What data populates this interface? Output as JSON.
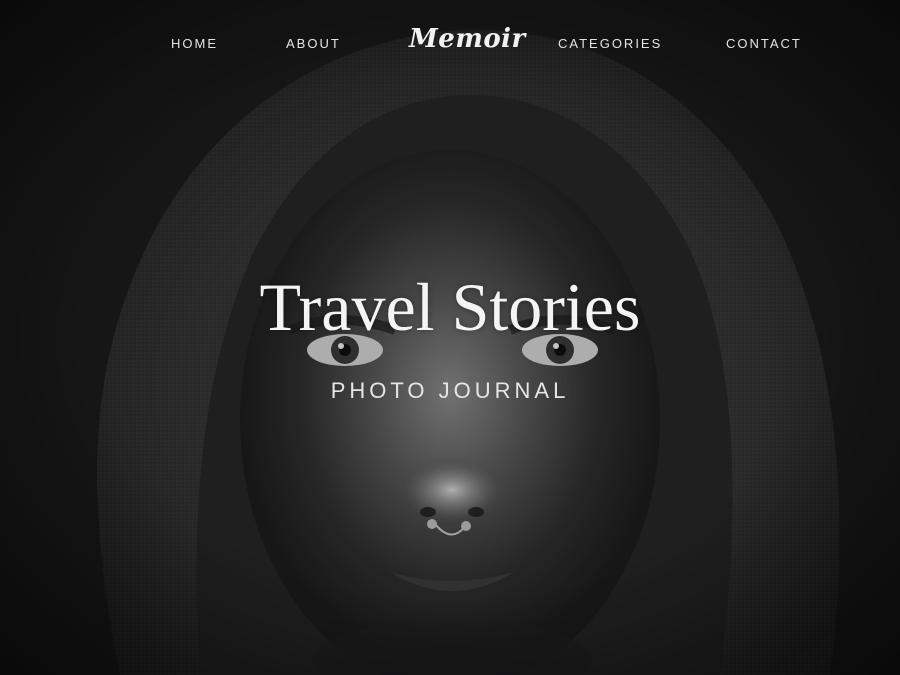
{
  "nav": {
    "home": "HOME",
    "about": "ABOUT",
    "logo": "Memoir",
    "categories": "CATEGORIES",
    "contact": "CONTACT"
  },
  "hero": {
    "title": "Travel Stories",
    "subtitle": "PHOTO JOURNAL",
    "image": "hooded-woman-portrait-photo"
  },
  "colors": {
    "background": "#1c1c1d",
    "text": "#f4f4f4"
  }
}
